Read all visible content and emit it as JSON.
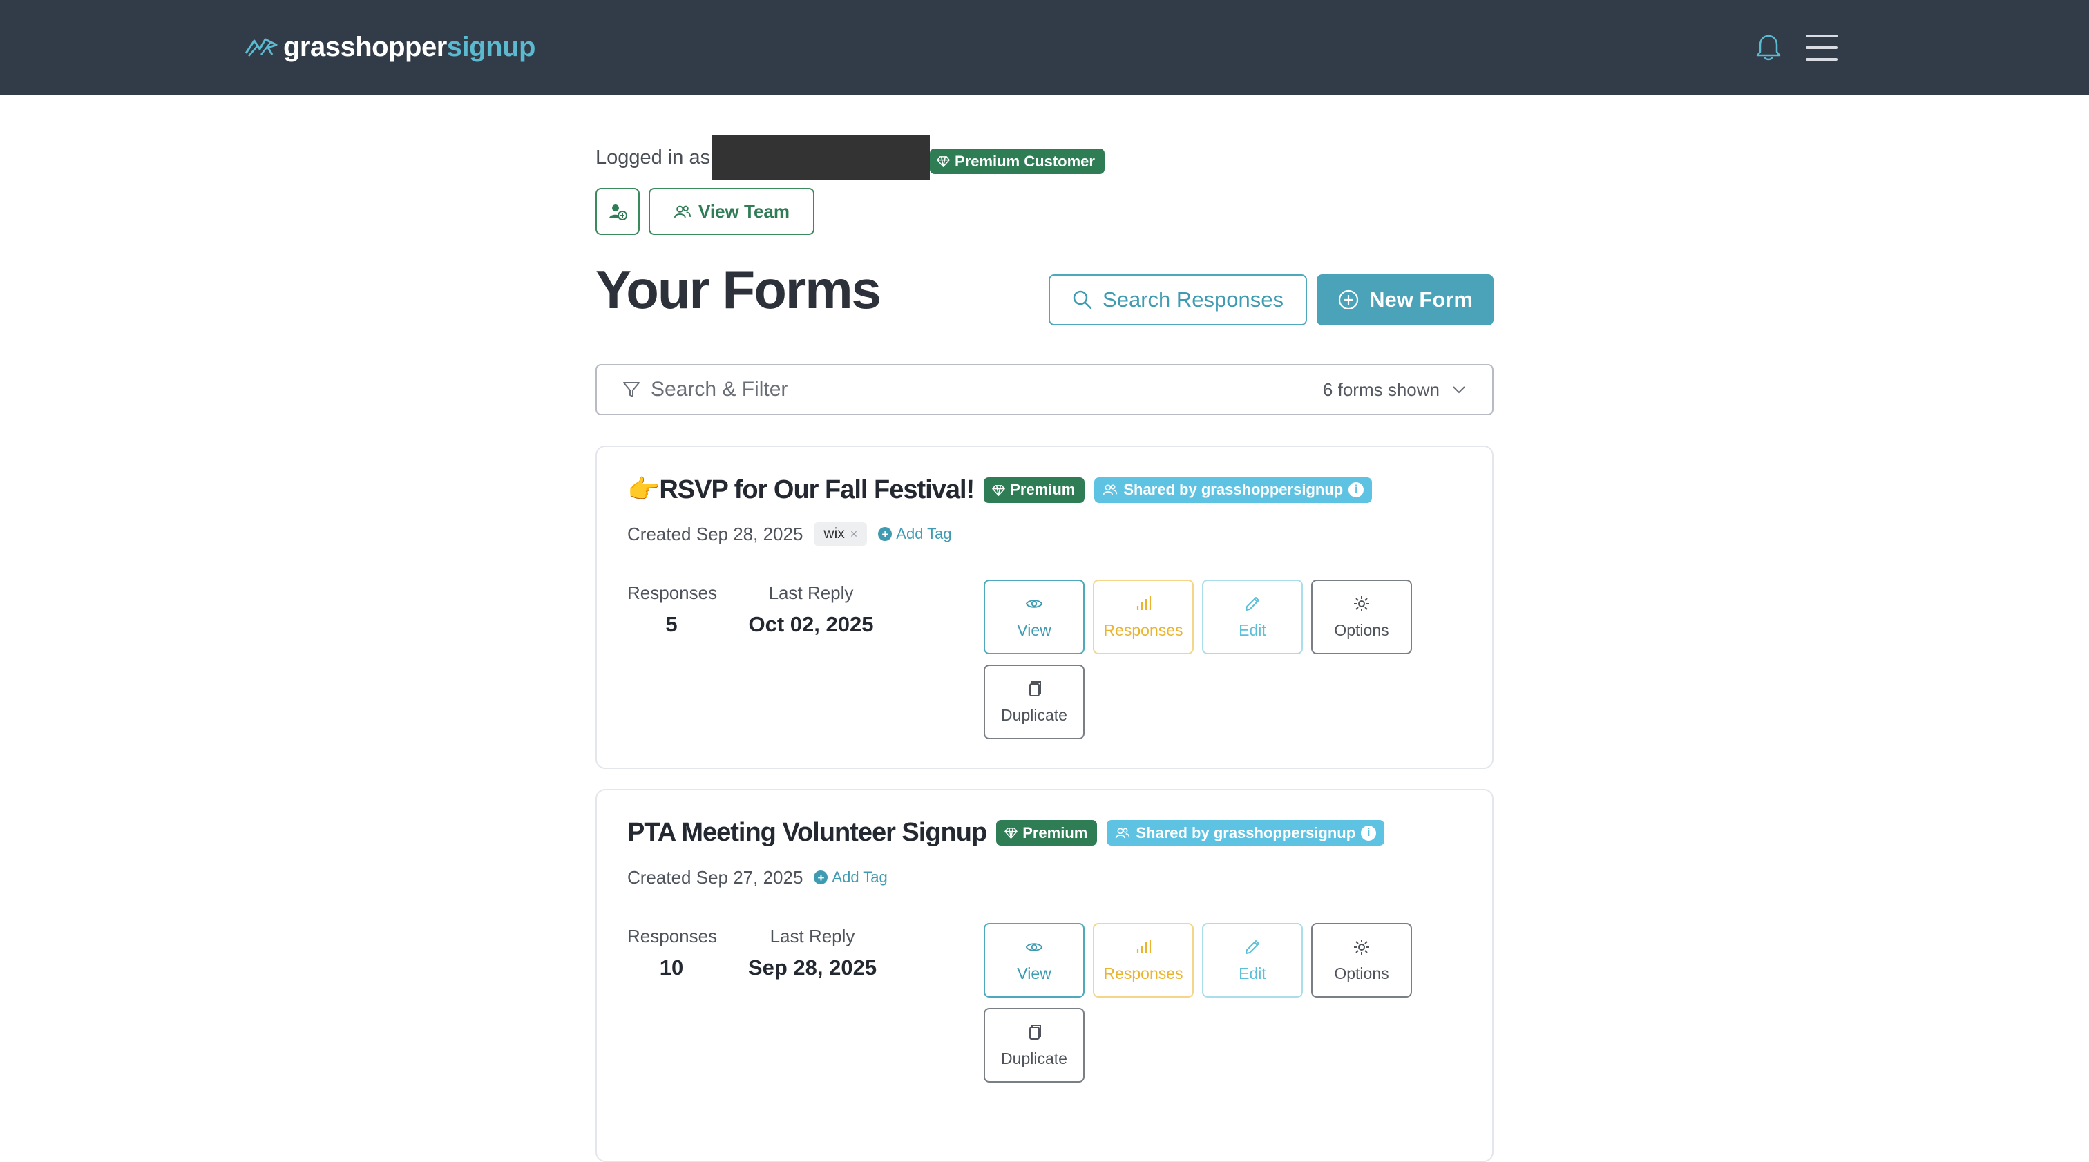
{
  "header": {
    "logo_part1": "grasshopper",
    "logo_part2": "signup",
    "bell_icon": "bell-icon",
    "menu_icon": "hamburger-menu-icon"
  },
  "account": {
    "logged_in_prefix": "Logged in as",
    "premium_badge": "Premium Customer",
    "view_team_label": "View Team"
  },
  "page": {
    "title": "Your Forms",
    "search_responses_label": "Search Responses",
    "new_form_label": "New Form"
  },
  "filter": {
    "label": "Search & Filter",
    "count": "6 forms shown"
  },
  "forms": [
    {
      "emoji": "👉",
      "title": "RSVP for Our Fall Festival!",
      "premium_badge": "Premium",
      "shared_badge": "Shared by grasshoppersignup",
      "created": "Created Sep 28, 2025",
      "tag": "wix",
      "add_tag": "Add Tag",
      "responses_label": "Responses",
      "responses_value": "5",
      "last_reply_label": "Last Reply",
      "last_reply_value": "Oct 02, 2025",
      "actions": {
        "view": "View",
        "responses": "Responses",
        "edit": "Edit",
        "options": "Options",
        "duplicate": "Duplicate"
      }
    },
    {
      "title": "PTA Meeting Volunteer Signup",
      "premium_badge": "Premium",
      "shared_badge": "Shared by grasshoppersignup",
      "created": "Created Sep 27, 2025",
      "add_tag": "Add Tag",
      "responses_label": "Responses",
      "responses_value": "10",
      "last_reply_label": "Last Reply",
      "last_reply_value": "Sep 28, 2025",
      "actions": {
        "view": "View",
        "responses": "Responses",
        "edit": "Edit",
        "options": "Options",
        "duplicate": "Duplicate"
      }
    }
  ],
  "colors": {
    "header_bg": "#323b48",
    "brand_teal": "#4aa3b8",
    "premium_green": "#2f7d55",
    "shared_blue": "#5ec3e3",
    "responses_yellow": "#eab42f"
  }
}
